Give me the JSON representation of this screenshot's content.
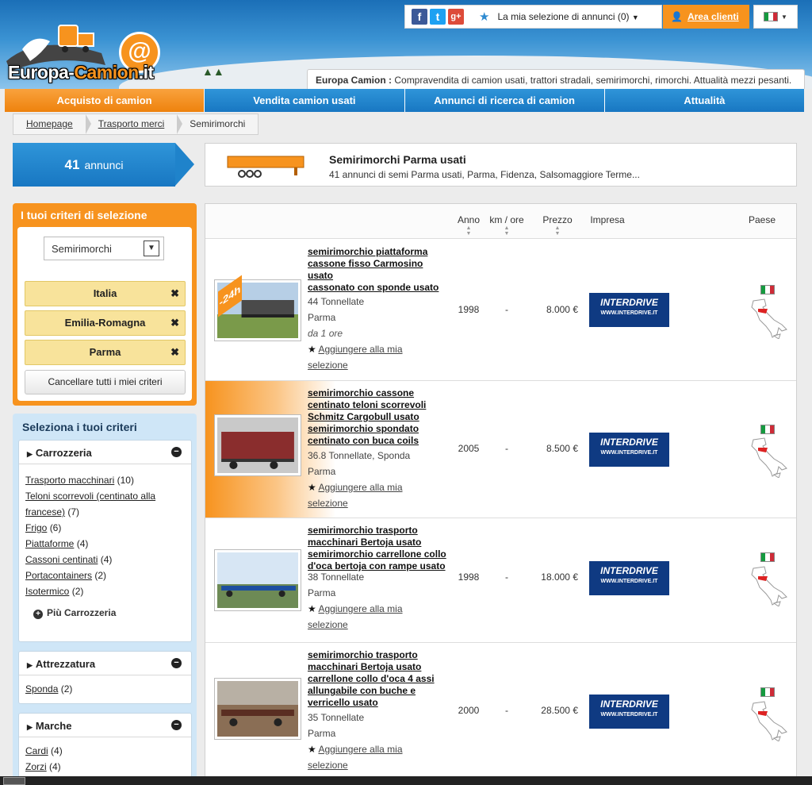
{
  "site": {
    "logo": "Europa-Camion.it",
    "logo_a": "Europa-",
    "logo_b": "Camion",
    "logo_c": ".it",
    "tagline_brand": "Europa Camion :",
    "tagline": " Compravendita di camion usati, trattori stradali, semirimorchi, rimorchi. Attualità mezzi pesanti."
  },
  "topbar": {
    "facebook": "f",
    "twitter": "t",
    "google": "g+",
    "selection": "La mia selezione di annunci (0)",
    "area": "Area clienti"
  },
  "nav": [
    "Acquisto di camion",
    "Vendita camion usati",
    "Annunci di ricerca di camion",
    "Attualità"
  ],
  "breadcrumb": [
    "Homepage",
    "Trasporto merci",
    "Semirimorchi"
  ],
  "count": {
    "num": "41",
    "label": "annunci"
  },
  "heading": {
    "title": "Semirimorchi Parma usati",
    "subtitle": "41 annunci di semi Parma usati, Parma, Fidenza, Salsomaggiore Terme..."
  },
  "criteria": {
    "title": "I tuoi criteri di selezione",
    "select_value": "Semirimorchi",
    "items": [
      "Italia",
      "Emilia-Romagna",
      "Parma"
    ],
    "clear": "Cancellare tutti i miei criteri"
  },
  "filters": {
    "title": "Seleziona i tuoi criteri",
    "carrozzeria": {
      "label": "Carrozzeria",
      "items": [
        {
          "name": "Trasporto macchinari",
          "count": "(10)"
        },
        {
          "name": "Teloni scorrevoli (centinato alla",
          "name2": "francese)",
          "count": "(7)"
        },
        {
          "name": "Frigo",
          "count": "(6)"
        },
        {
          "name": "Piattaforme",
          "count": "(4)"
        },
        {
          "name": "Cassoni centinati",
          "count": "(4)"
        },
        {
          "name": "Portacontainers",
          "count": "(2)"
        },
        {
          "name": "Isotermico",
          "count": "(2)"
        }
      ],
      "more": "Più Carrozzeria"
    },
    "attrezzatura": {
      "label": "Attrezzatura",
      "items": [
        {
          "name": "Sponda",
          "count": "(2)"
        }
      ]
    },
    "marche": {
      "label": "Marche",
      "items": [
        {
          "name": "Cardi",
          "count": "(4)"
        },
        {
          "name": "Zorzi",
          "count": "(4)"
        }
      ]
    }
  },
  "columns": {
    "anno": "Anno",
    "km": "km / ore",
    "prezzo": "Prezzo",
    "impresa": "Impresa",
    "paese": "Paese"
  },
  "listings": [
    {
      "title": [
        "semirimorchio piattaforma",
        "cassone fisso Carmosino",
        "usato",
        "cassonato con sponde usato"
      ],
      "spec": "44 Tonnellate",
      "city": "Parma",
      "age": "da 1 ore",
      "add": "Aggiungere alla mia",
      "add2": "selezione",
      "year": "1998",
      "km": "-",
      "price": "8.000 €",
      "company": "INTERDRIVE",
      "company_url": "WWW.INTERDRIVE.IT",
      "badge": "-24h"
    },
    {
      "title": [
        "semirimorchio cassone",
        "centinato teloni scorrevoli",
        "Schmitz Cargobull usato",
        "semirimorchio spondato",
        "centinato con buca coils"
      ],
      "spec": "36.8 Tonnellate, Sponda",
      "city": "Parma",
      "add": "Aggiungere alla mia",
      "add2": "selezione",
      "year": "2005",
      "km": "-",
      "price": "8.500 €",
      "company": "INTERDRIVE",
      "company_url": "WWW.INTERDRIVE.IT"
    },
    {
      "title": [
        "semirimorchio trasporto",
        "macchinari Bertoja usato",
        "semirimorchio carrellone collo",
        "d'oca bertoja con rampe usato"
      ],
      "spec": "38 Tonnellate",
      "city": "Parma",
      "add": "Aggiungere alla mia",
      "add2": "selezione",
      "year": "1998",
      "km": "-",
      "price": "18.000 €",
      "company": "INTERDRIVE",
      "company_url": "WWW.INTERDRIVE.IT"
    },
    {
      "title": [
        "semirimorchio trasporto",
        "macchinari Bertoja usato",
        "carrellone collo d'oca 4 assi",
        "allungabile con buche e",
        "verricello usato"
      ],
      "spec": "35 Tonnellate",
      "city": "Parma",
      "add": "Aggiungere alla mia",
      "add2": "selezione",
      "year": "2000",
      "km": "-",
      "price": "28.500 €",
      "company": "INTERDRIVE",
      "company_url": "WWW.INTERDRIVE.IT"
    }
  ],
  "colors": {
    "orange": "#f7931e",
    "blue": "#1f83cb",
    "company_bg": "#0f3a82"
  }
}
